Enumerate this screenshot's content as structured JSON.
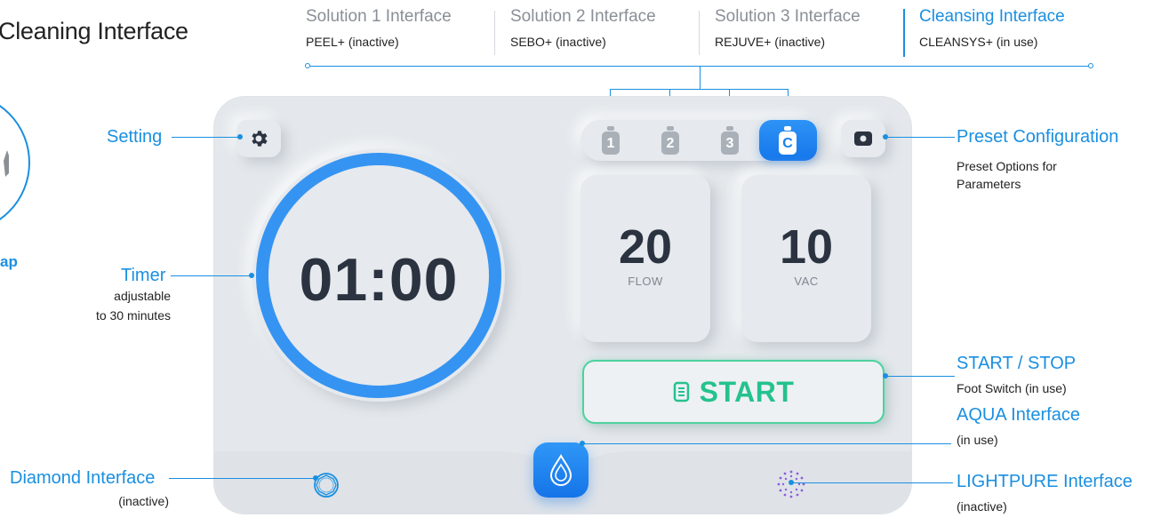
{
  "page_title": "Cleaning Interface",
  "left_edge_label": "ap",
  "tabs": [
    {
      "title": "Solution 1 Interface",
      "sub": "PEEL+ (inactive)",
      "active": false
    },
    {
      "title": "Solution 2 Interface",
      "sub": "SEBO+ (inactive)",
      "active": false
    },
    {
      "title": "Solution 3 Interface",
      "sub": "REJUVE+ (inactive)",
      "active": false
    },
    {
      "title": "Cleansing Interface",
      "sub": "CLEANSYS+ (in use)",
      "active": true
    }
  ],
  "callouts": {
    "setting": {
      "title": "Setting"
    },
    "timer": {
      "title": "Timer",
      "sub1": "adjustable",
      "sub2": "to 30 minutes"
    },
    "diamond": {
      "title": "Diamond Interface",
      "sub": "(inactive)"
    },
    "preset": {
      "title": "Preset Configuration",
      "sub1": "Preset Options for",
      "sub2": "Parameters"
    },
    "start_stop": {
      "title": "START / STOP",
      "sub": "Foot Switch (in use)"
    },
    "aqua": {
      "title": "AQUA Interface",
      "sub": "(in use)"
    },
    "lightpure": {
      "title": "LIGHTPURE Interface",
      "sub": "(inactive)"
    }
  },
  "device": {
    "bottles": [
      "1",
      "2",
      "3",
      "C"
    ],
    "active_bottle": "C",
    "timer": "01:00",
    "flow": {
      "value": "20",
      "label": "FLOW"
    },
    "vac": {
      "value": "10",
      "label": "VAC"
    },
    "start_label": "START"
  },
  "icons": {
    "setting": "gear-icon",
    "preset": "camera-icon",
    "start": "document-icon",
    "aqua": "water-drop-icon",
    "diamond": "diamond-ring-icon",
    "lightpure": "light-burst-icon"
  },
  "colors": {
    "accent": "#1a8fe0",
    "start_green": "#25c28d",
    "panel": "#e4e8ec"
  }
}
